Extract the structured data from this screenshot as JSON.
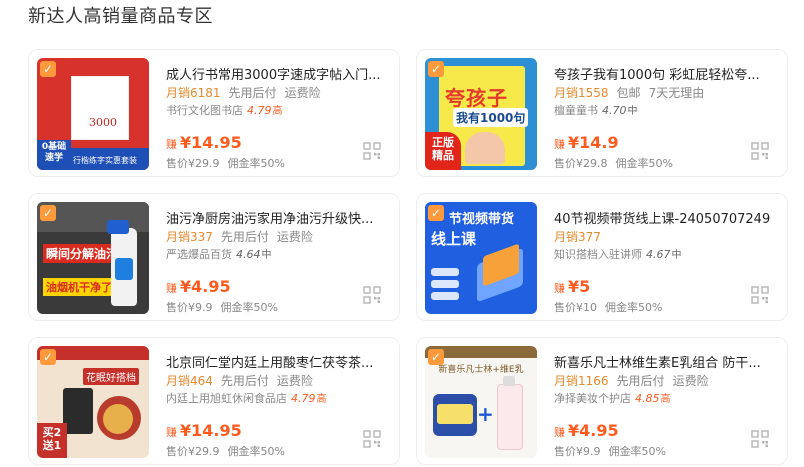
{
  "section_title": "新达人高销量商品专区",
  "labels": {
    "earn": "赚",
    "sales_prefix": "月销",
    "price_prefix": "售价",
    "commission_prefix": "佣金率"
  },
  "products": [
    {
      "name": "成人行书常用3000字速成字帖入门...",
      "sales": "月销6181",
      "tags": [
        "先用后付",
        "运费险"
      ],
      "shop": "书行文化图书店",
      "score": "4.79",
      "level": "高",
      "earn": "¥14.95",
      "price": "售价¥29.9",
      "commission": "佣金率50%",
      "image_icon": "calligraphy-copybook-image",
      "image_text": {
        "badge": "0基础\n速学",
        "strip": "行楷练字实惠套装",
        "cover": "3000"
      }
    },
    {
      "name": "夸孩子我有1000句 彩虹屁轻松夸...",
      "sales": "月销1558",
      "tags": [
        "包邮",
        "7天无理由"
      ],
      "shop": "檀童童书",
      "score": "4.70",
      "level": "中",
      "earn": "¥14.9",
      "price": "售价¥29.8",
      "commission": "佣金率50%",
      "image_icon": "book-cover-image",
      "image_text": {
        "badge": "正版\n精品",
        "cover_title": "夸孩子",
        "cover_sub": "我有1000句"
      }
    },
    {
      "name": "油污净厨房油污家用净油污升级快...",
      "sales": "月销337",
      "tags": [
        "先用后付",
        "运费险"
      ],
      "shop": "严选爆品百货",
      "score": "4.64",
      "level": "中",
      "earn": "¥4.95",
      "price": "售价¥9.9",
      "commission": "佣金率50%",
      "image_icon": "cleaner-spray-image",
      "image_text": {
        "line1": "瞬间分解油污",
        "line2": "油烟机干净了"
      }
    },
    {
      "name": "40节视频带货线上课-24050707249",
      "sales": "月销377",
      "tags": [],
      "shop": "知识搭档入驻讲师",
      "score": "4.67",
      "level": "中",
      "earn": "¥5",
      "price": "售价¥10",
      "commission": "佣金率50%",
      "image_icon": "course-banner-image",
      "image_text": {
        "line1": "节视频带货",
        "line2": "线上课"
      }
    },
    {
      "name": "北京同仁堂内廷上用酸枣仁茯苓茶...",
      "sales": "月销464",
      "tags": [
        "先用后付",
        "运费险"
      ],
      "shop": "内廷上用旭虹休闲食品店",
      "score": "4.79",
      "level": "高",
      "earn": "¥14.95",
      "price": "售价¥29.9",
      "commission": "佣金率50%",
      "image_icon": "herbal-tea-image",
      "image_text": {
        "tag": "花眠好搭档",
        "badge": "买2\n送1"
      }
    },
    {
      "name": "新喜乐凡士林维生素E乳组合 防干...",
      "sales": "月销1166",
      "tags": [
        "先用后付",
        "运费险"
      ],
      "shop": "净择美妆个护店",
      "score": "4.85",
      "level": "高",
      "earn": "¥4.95",
      "price": "售价¥9.9",
      "commission": "佣金率50%",
      "image_icon": "vaseline-set-image",
      "image_text": {
        "header": "新喜乐凡士林+维E乳"
      }
    }
  ]
}
